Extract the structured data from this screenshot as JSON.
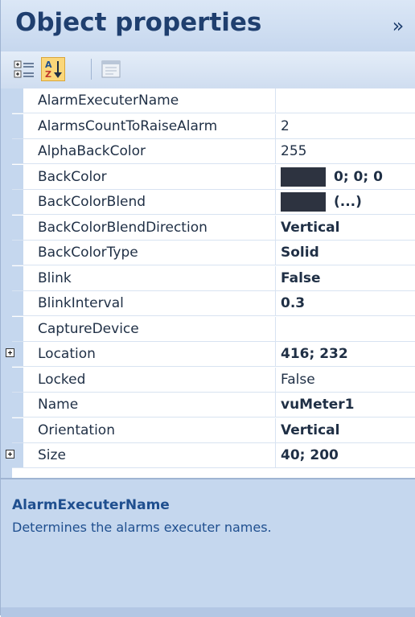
{
  "panel": {
    "title": "Object properties",
    "collapse_glyph": "»"
  },
  "toolbar": {
    "buttons": [
      {
        "icon": "categorized-icon"
      },
      {
        "icon": "alphabetical-sort-icon"
      },
      {
        "icon": "property-pages-icon"
      }
    ]
  },
  "properties": [
    {
      "name": "AlarmExecuterName",
      "value": "",
      "bold": false,
      "expandable": false
    },
    {
      "name": "AlarmsCountToRaiseAlarm",
      "value": "2",
      "bold": false,
      "expandable": false
    },
    {
      "name": "AlphaBackColor",
      "value": "255",
      "bold": false,
      "expandable": false
    },
    {
      "name": "BackColor",
      "value": "0; 0; 0",
      "bold": true,
      "expandable": false,
      "swatch": "#2d3340"
    },
    {
      "name": "BackColorBlend",
      "value": "(...)",
      "bold": true,
      "expandable": false,
      "swatch": "#2d3340"
    },
    {
      "name": "BackColorBlendDirection",
      "value": "Vertical",
      "bold": true,
      "expandable": false
    },
    {
      "name": "BackColorType",
      "value": "Solid",
      "bold": true,
      "expandable": false
    },
    {
      "name": "Blink",
      "value": "False",
      "bold": true,
      "expandable": false
    },
    {
      "name": "BlinkInterval",
      "value": "0.3",
      "bold": true,
      "expandable": false
    },
    {
      "name": "CaptureDevice",
      "value": "",
      "bold": false,
      "expandable": false
    },
    {
      "name": "Location",
      "value": "416; 232",
      "bold": true,
      "expandable": true
    },
    {
      "name": "Locked",
      "value": "False",
      "bold": false,
      "expandable": false
    },
    {
      "name": "Name",
      "value": "vuMeter1",
      "bold": true,
      "expandable": false
    },
    {
      "name": "Orientation",
      "value": "Vertical",
      "bold": true,
      "expandable": false
    },
    {
      "name": "Size",
      "value": "40; 200",
      "bold": true,
      "expandable": true
    }
  ],
  "description": {
    "title": "AlarmExecuterName",
    "text": "Determines the alarms executer names."
  },
  "colors": {
    "panel_bg": "#c5d7ee",
    "title_text": "#1f3f6f",
    "desc_text": "#1f4f8f",
    "swatch": "#2d3340"
  }
}
